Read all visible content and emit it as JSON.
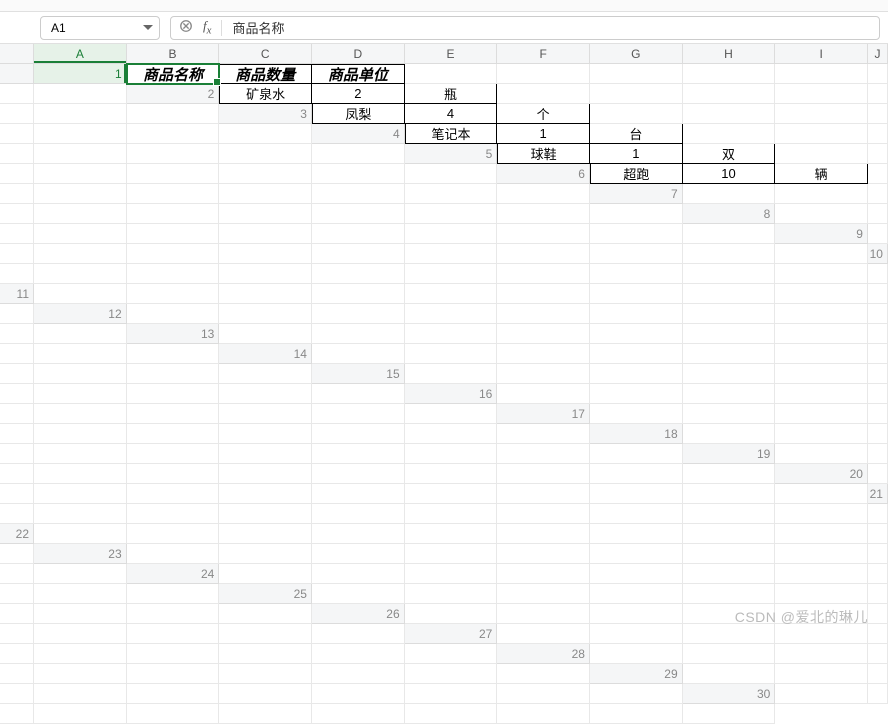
{
  "name_box": {
    "ref": "A1"
  },
  "formula_bar": {
    "value": "商品名称"
  },
  "columns": [
    "A",
    "B",
    "C",
    "D",
    "E",
    "F",
    "G",
    "H",
    "I",
    "J"
  ],
  "row_count": 30,
  "active": {
    "row": 1,
    "col": "A"
  },
  "table": {
    "headers": [
      "商品名称",
      "商品数量",
      "商品单位"
    ],
    "rows": [
      [
        "矿泉水",
        "2",
        "瓶"
      ],
      [
        "凤梨",
        "4",
        "个"
      ],
      [
        "笔记本",
        "1",
        "台"
      ],
      [
        "球鞋",
        "1",
        "双"
      ],
      [
        "超跑",
        "10",
        "辆"
      ]
    ]
  },
  "watermark": "CSDN @爱北的琳儿"
}
